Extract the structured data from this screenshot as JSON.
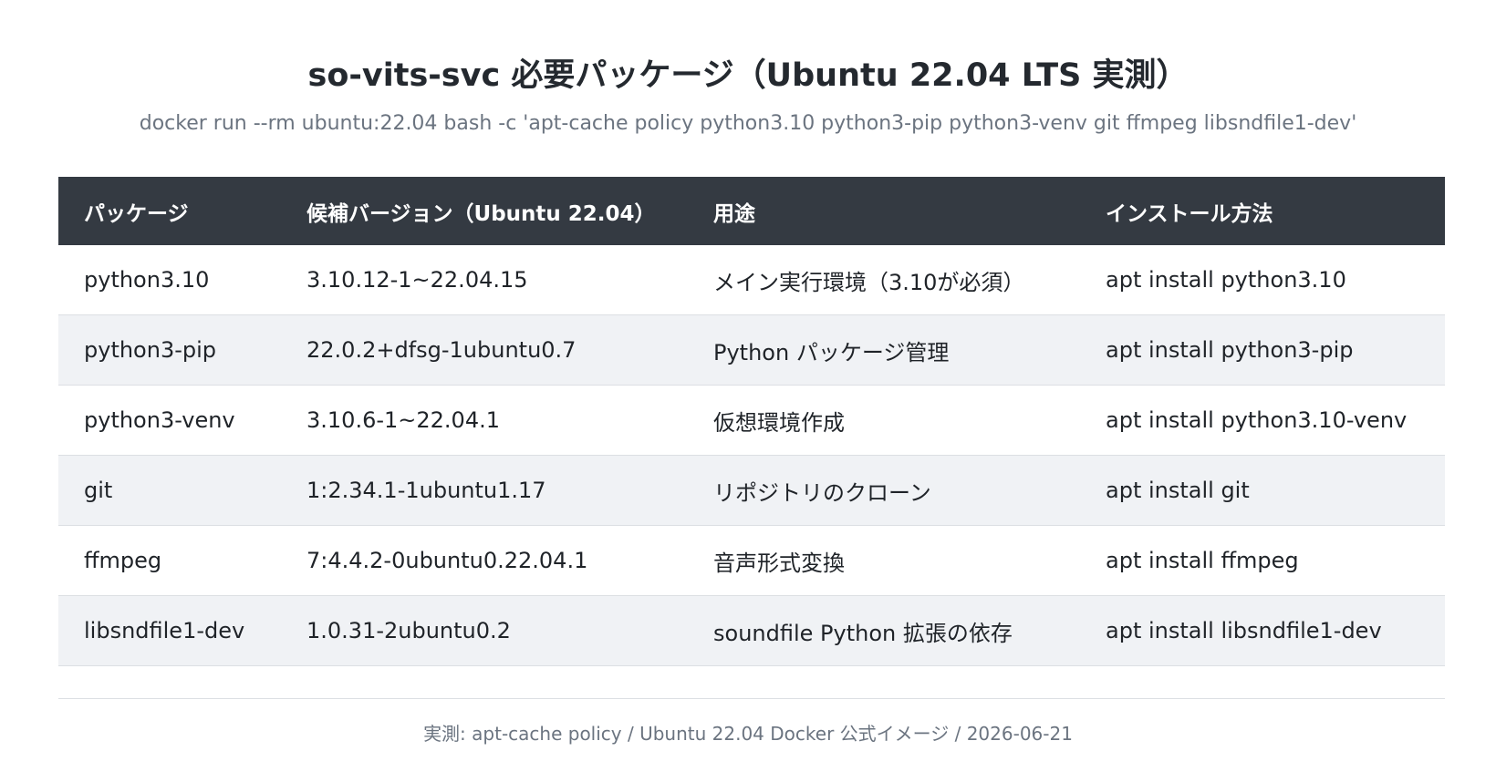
{
  "header": {
    "title": "so-vits-svc 必要パッケージ（Ubuntu 22.04 LTS 実測）",
    "command": "docker run --rm ubuntu:22.04 bash -c 'apt-cache policy python3.10 python3-pip python3-venv git ffmpeg libsndfile1-dev'"
  },
  "table": {
    "columns": [
      "パッケージ",
      "候補バージョン（Ubuntu 22.04）",
      "用途",
      "インストール方法"
    ],
    "rows": [
      {
        "package": "python3.10",
        "version": "3.10.12-1~22.04.15",
        "purpose": "メイン実行環境（3.10が必須）",
        "install": "apt install python3.10"
      },
      {
        "package": "python3-pip",
        "version": "22.0.2+dfsg-1ubuntu0.7",
        "purpose": "Python パッケージ管理",
        "install": "apt install python3-pip"
      },
      {
        "package": "python3-venv",
        "version": "3.10.6-1~22.04.1",
        "purpose": "仮想環境作成",
        "install": "apt install python3.10-venv"
      },
      {
        "package": "git",
        "version": "1:2.34.1-1ubuntu1.17",
        "purpose": "リポジトリのクローン",
        "install": "apt install git"
      },
      {
        "package": "ffmpeg",
        "version": "7:4.4.2-0ubuntu0.22.04.1",
        "purpose": "音声形式変換",
        "install": "apt install ffmpeg"
      },
      {
        "package": "libsndfile1-dev",
        "version": "1.0.31-2ubuntu0.2",
        "purpose": "soundfile Python 拡張の依存",
        "install": "apt install libsndfile1-dev"
      }
    ]
  },
  "footer": {
    "note": "実測: apt-cache policy / Ubuntu 22.04 Docker 公式イメージ / 2026-06-21"
  },
  "colors": {
    "header_bg": "#343a42",
    "alt_row_bg": "#f0f2f5",
    "muted_text": "#6b7480"
  }
}
